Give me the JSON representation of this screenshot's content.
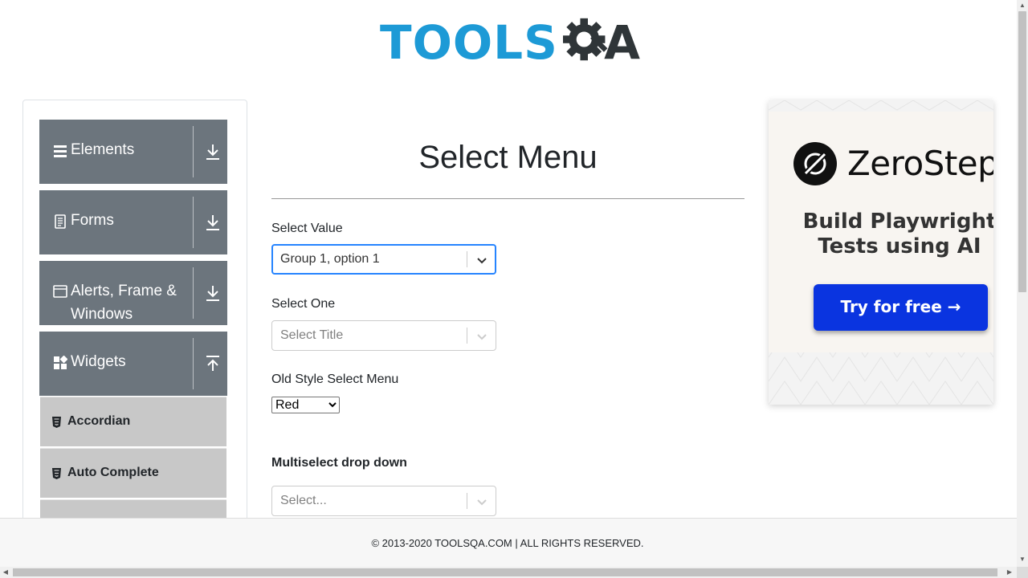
{
  "header": {
    "logo_text_blue": "TOOLS",
    "logo_text_dark": "A"
  },
  "sidebar": {
    "groups": [
      {
        "label": "Elements",
        "icon": "hamburger-icon",
        "arrow": "download-icon"
      },
      {
        "label": "Forms",
        "icon": "document-icon",
        "arrow": "download-icon"
      },
      {
        "label": "Alerts, Frame &",
        "label_line2": "Windows",
        "icon": "window-icon",
        "arrow": "download-icon"
      },
      {
        "label": "Widgets",
        "icon": "widgets-icon",
        "arrow": "upload-icon"
      }
    ],
    "items": [
      {
        "label": "Accordian",
        "icon": "html5-icon"
      },
      {
        "label": "Auto Complete",
        "icon": "html5-icon"
      }
    ]
  },
  "main": {
    "title": "Select Menu",
    "select_value": {
      "label": "Select Value",
      "value": "Group 1, option 1"
    },
    "select_one": {
      "label": "Select One",
      "placeholder": "Select Title"
    },
    "old_style": {
      "label": "Old Style Select Menu",
      "value": "Red"
    },
    "multiselect": {
      "label": "Multiselect drop down",
      "placeholder": "Select..."
    }
  },
  "ad": {
    "brand": "ZeroStep",
    "headline_line1": "Build Playwright",
    "headline_line2": "Tests using AI",
    "cta": "Try for free →"
  },
  "footer": {
    "text": "© 2013-2020 TOOLSQA.COM | ALL RIGHTS RESERVED."
  },
  "colors": {
    "accent_blue": "#1d9ad6",
    "sidebar_group_bg": "#6c757d",
    "sidebar_item_bg": "#c8c8c8",
    "focus_border": "#2684ff",
    "cta_blue": "#0a34e0"
  }
}
